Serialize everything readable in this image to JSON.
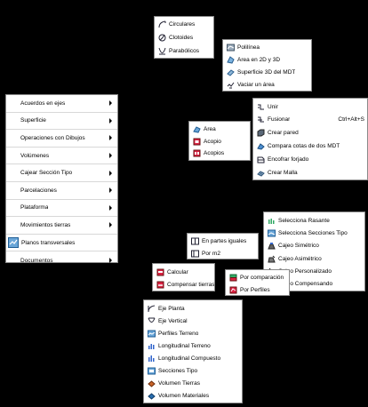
{
  "main_menu": {
    "items": [
      {
        "label": "Acuerdos en ejes",
        "submenu": true
      },
      {
        "label": "Superficie",
        "submenu": true
      },
      {
        "label": "Operaciones con Dibujos",
        "submenu": true
      },
      {
        "label": "Volúmenes",
        "submenu": true
      },
      {
        "label": "Cajear Sección Tipo",
        "submenu": true
      },
      {
        "label": "Parcelaciones",
        "submenu": true
      },
      {
        "label": "Plataforma",
        "submenu": true
      },
      {
        "label": "Movimientos tierras",
        "submenu": true
      },
      {
        "label": "Planos transversales",
        "submenu": false,
        "icon": "transversal-plans-icon"
      },
      {
        "label": "Documentos",
        "submenu": true
      }
    ]
  },
  "acuerdos_menu": {
    "items": [
      {
        "label": "Circulares",
        "icon": "circular-curve-icon"
      },
      {
        "label": "Clotoides",
        "icon": "clothoid-icon"
      },
      {
        "label": "Parabólicos",
        "icon": "parabolic-icon"
      }
    ]
  },
  "superficie_menu": {
    "items": [
      {
        "label": "Polilínea",
        "icon": "polyline-icon"
      },
      {
        "label": "Área en 2D y 3D",
        "icon": "area-2d-3d-icon"
      },
      {
        "label": "Superficie 3D del MDT",
        "icon": "surface-3d-icon"
      },
      {
        "label": "Vaciar un área",
        "icon": "empty-area-icon"
      }
    ]
  },
  "operaciones_menu": {
    "items": [
      {
        "label": "Unir",
        "icon": "join-icon",
        "shortcut": ""
      },
      {
        "label": "Fusionar",
        "icon": "merge-icon",
        "shortcut": "Ctrl+Alt+S"
      },
      {
        "label": "Crear pared",
        "icon": "wall-icon",
        "shortcut": ""
      },
      {
        "label": "Compara cotas de dos MDT",
        "icon": "compare-dtm-icon",
        "shortcut": ""
      },
      {
        "label": "Encofrar forjado",
        "icon": "formwork-icon",
        "shortcut": ""
      },
      {
        "label": "Crear Malla",
        "icon": "mesh-icon",
        "shortcut": ""
      }
    ]
  },
  "volumenes_menu": {
    "items": [
      {
        "label": "Área",
        "icon": "area-icon"
      },
      {
        "label": "Acopio",
        "icon": "stockpile-icon"
      },
      {
        "label": "Acopios",
        "icon": "stockpiles-icon"
      }
    ]
  },
  "cajear_menu": {
    "items": [
      {
        "label": "Selecciona Rasante",
        "icon": "grade-line-icon"
      },
      {
        "label": "Selecciona Secciones Tipo",
        "icon": "typical-sections-icon"
      },
      {
        "label": "Cajeo Simétrico",
        "icon": "symmetric-icon"
      },
      {
        "label": "Cajeo Asimétrico",
        "icon": "asymmetric-icon"
      },
      {
        "label": "Cajeo Personalizado",
        "icon": "custom-icon"
      },
      {
        "label": "Cajeo Compensando",
        "icon": "compensated-icon"
      }
    ]
  },
  "parcelaciones_menu": {
    "items": [
      {
        "label": "En partes iguales",
        "icon": "equal-parts-icon"
      },
      {
        "label": "Por m2",
        "icon": "per-m2-icon"
      }
    ]
  },
  "plataforma_menu": {
    "items": [
      {
        "label": "Calcular",
        "icon": "calculate-icon"
      },
      {
        "label": "Compensar tierras",
        "icon": "balance-earth-icon"
      }
    ]
  },
  "movimientos_menu": {
    "items": [
      {
        "label": "Por comparación",
        "icon": "by-comparison-icon"
      },
      {
        "label": "Por Perfiles",
        "icon": "by-profiles-icon"
      }
    ]
  },
  "documentos_menu": {
    "items": [
      {
        "label": "Eje Planta",
        "icon": "plan-axis-icon"
      },
      {
        "label": "Eje Vertical",
        "icon": "vertical-axis-icon"
      },
      {
        "label": "Perfiles Terreno",
        "icon": "terrain-profiles-icon"
      },
      {
        "label": "Longitudinal Terreno",
        "icon": "longitudinal-terrain-icon"
      },
      {
        "label": "Longitudinal Compuesto",
        "icon": "longitudinal-composite-icon"
      },
      {
        "label": "Secciones Tipo",
        "icon": "sections-icon"
      },
      {
        "label": "Volumen Tierras",
        "icon": "earth-volume-icon"
      },
      {
        "label": "Volumen Materiales",
        "icon": "materials-volume-icon"
      }
    ]
  }
}
